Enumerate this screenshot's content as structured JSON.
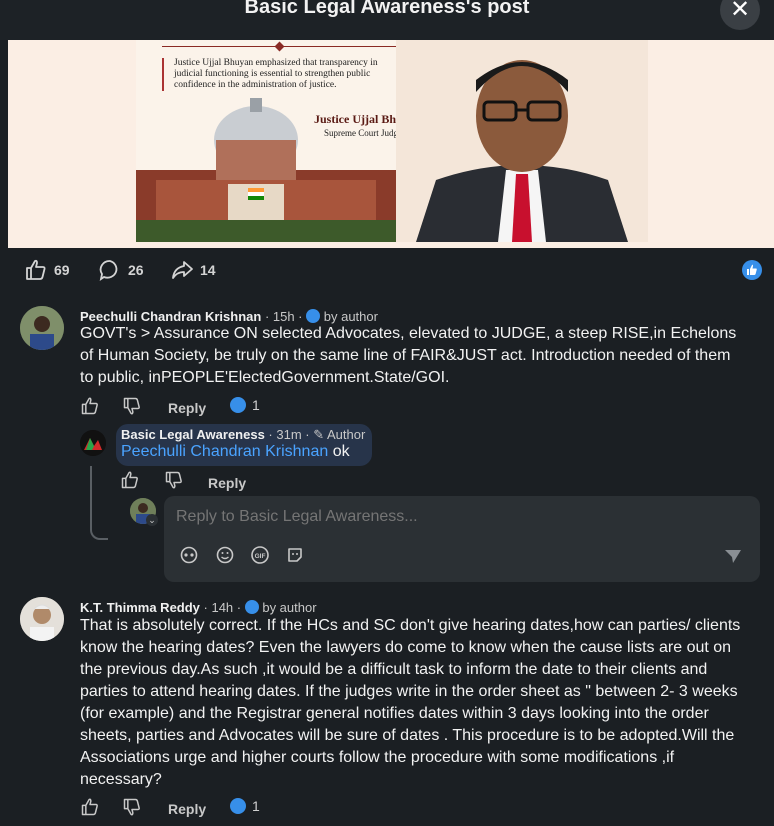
{
  "header": {
    "title": "Basic Legal Awareness's post",
    "close_icon": "close-icon"
  },
  "poster": {
    "quote": "Justice Ujjal Bhuyan emphasized that transparency in judicial functioning is essential to strengthen public confidence in the administration of justice.",
    "name": "Justice Ujjal Bhuyan",
    "role": "Supreme Court Judge"
  },
  "reactions": {
    "likes": "69",
    "comments": "26",
    "shares": "14"
  },
  "comment1": {
    "name": "Peechulli Chandran Krishnan",
    "meta": " · 15h · ",
    "by_author": "by author",
    "text": "GOVT's > Assurance ON selected Advocates, elevated to JUDGE, a steep RISE,in Echelons of Human Society, be truly on the same line of FAIR&JUST act. Introduction needed of them to public, inPEOPLE'ElectedGovernment.State/GOI.",
    "reply_label": "Reply",
    "like_count": "1"
  },
  "reply1": {
    "name": "Basic Legal Awareness",
    "meta": " · 31m · ",
    "author_tag": "Author",
    "mention": "Peechulli Chandran Krishnan",
    "text": " ok",
    "reply_label": "Reply"
  },
  "reply_box": {
    "placeholder": "Reply to Basic Legal Awareness..."
  },
  "comment2": {
    "name": "K.T. Thimma Reddy",
    "meta": " · 14h · ",
    "by_author": "by author",
    "text": "That is absolutely correct. If the HCs and SC don't give hearing dates,how can parties/ clients know the hearing dates? Even the lawyers do come to know when the cause lists are out on the previous day.As such ,it would be a difficult task to inform the date to their clients and parties to attend hearing dates. If the judges write in the order sheet as \" between 2- 3 weeks (for example) and the Registrar general notifies dates within 3 days looking into the order sheets, parties and Advocates will be sure of dates . This procedure is to be adopted.Will the Associations urge and higher courts follow the procedure with some modifications ,if necessary?",
    "reply_label": "Reply",
    "like_count": "1"
  },
  "colors": {
    "accent": "#378fe9",
    "mention": "#4aa3ff",
    "bubble": "#27344a"
  }
}
